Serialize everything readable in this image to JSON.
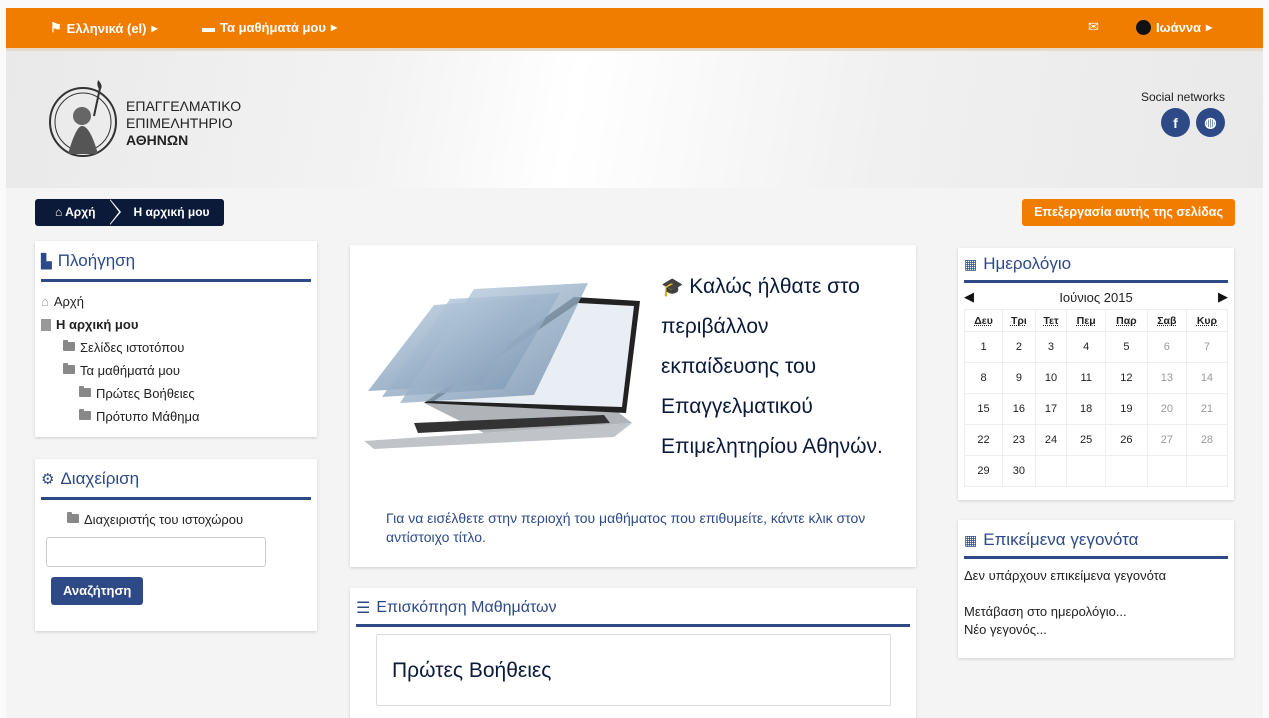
{
  "topbar": {
    "language": "Ελληνικά (el)",
    "my_courses": "Τα μαθήματά μου",
    "user": "Ιωάννα"
  },
  "header": {
    "logo_lines": [
      "ΕΠΑΓΓΕΛΜΑΤΙΚΟ",
      "ΕΠΙΜΕΛΗΤΗΡΙΟ",
      "ΑΘΗΝΩΝ"
    ],
    "social_label": "Social networks",
    "social_icons": [
      "facebook-icon",
      "globe-icon"
    ]
  },
  "breadcrumb": {
    "home": "Αρχή",
    "current": "Η αρχική μου"
  },
  "edit_button": "Επεξεργασία αυτής της σελίδας",
  "navigation": {
    "title": "Πλοήγηση",
    "items": [
      {
        "label": "Αρχή"
      },
      {
        "label": "Η αρχική μου"
      },
      {
        "label": "Σελίδες ιστοτόπου"
      },
      {
        "label": "Τα μαθήματά μου"
      },
      {
        "label": "Πρώτες Βοήθειες"
      },
      {
        "label": "Πρότυπο Μάθημα"
      }
    ]
  },
  "admin": {
    "title": "Διαχείριση",
    "item": "Διαχειριστής του ιστοχώρου",
    "search_placeholder": "",
    "search_button": "Αναζήτηση"
  },
  "welcome": {
    "title_lines": [
      "Καλώς ήλθατε στο",
      "περιβάλλον",
      "εκπαίδευσης του",
      "Επαγγελματικού",
      "Επιμελητηρίου Αθηνών."
    ],
    "note": "Για να εισέλθετε στην περιοχή του μαθήματος που επιθυμείτε, κάντε κλικ στον αντίστοιχο τίτλο."
  },
  "courses_overview": {
    "title": "Επισκόπηση Μαθημάτων",
    "first_course": "Πρώτες Βοήθειες"
  },
  "calendar": {
    "title": "Ημερολόγιο",
    "month": "Ιούνιος 2015",
    "weekdays": [
      "Δευ",
      "Τρι",
      "Τετ",
      "Πεμ",
      "Παρ",
      "Σαβ",
      "Κυρ"
    ],
    "weeks": [
      [
        "1",
        "2",
        "3",
        "4",
        "5",
        "6",
        "7"
      ],
      [
        "8",
        "9",
        "10",
        "11",
        "12",
        "13",
        "14"
      ],
      [
        "15",
        "16",
        "17",
        "18",
        "19",
        "20",
        "21"
      ],
      [
        "22",
        "23",
        "24",
        "25",
        "26",
        "27",
        "28"
      ],
      [
        "29",
        "30",
        "",
        "",
        "",
        "",
        ""
      ]
    ]
  },
  "events": {
    "title": "Επικείμενα γεγονότα",
    "none": "Δεν υπάρχουν επικείμενα γεγονότα",
    "goto_calendar": "Μετάβαση στο ημερολόγιο...",
    "new_event": "Νέο γεγονός..."
  },
  "colors": {
    "topbar": "#f07d00",
    "primary": "#2d4a87",
    "dark": "#0c1a3a"
  }
}
